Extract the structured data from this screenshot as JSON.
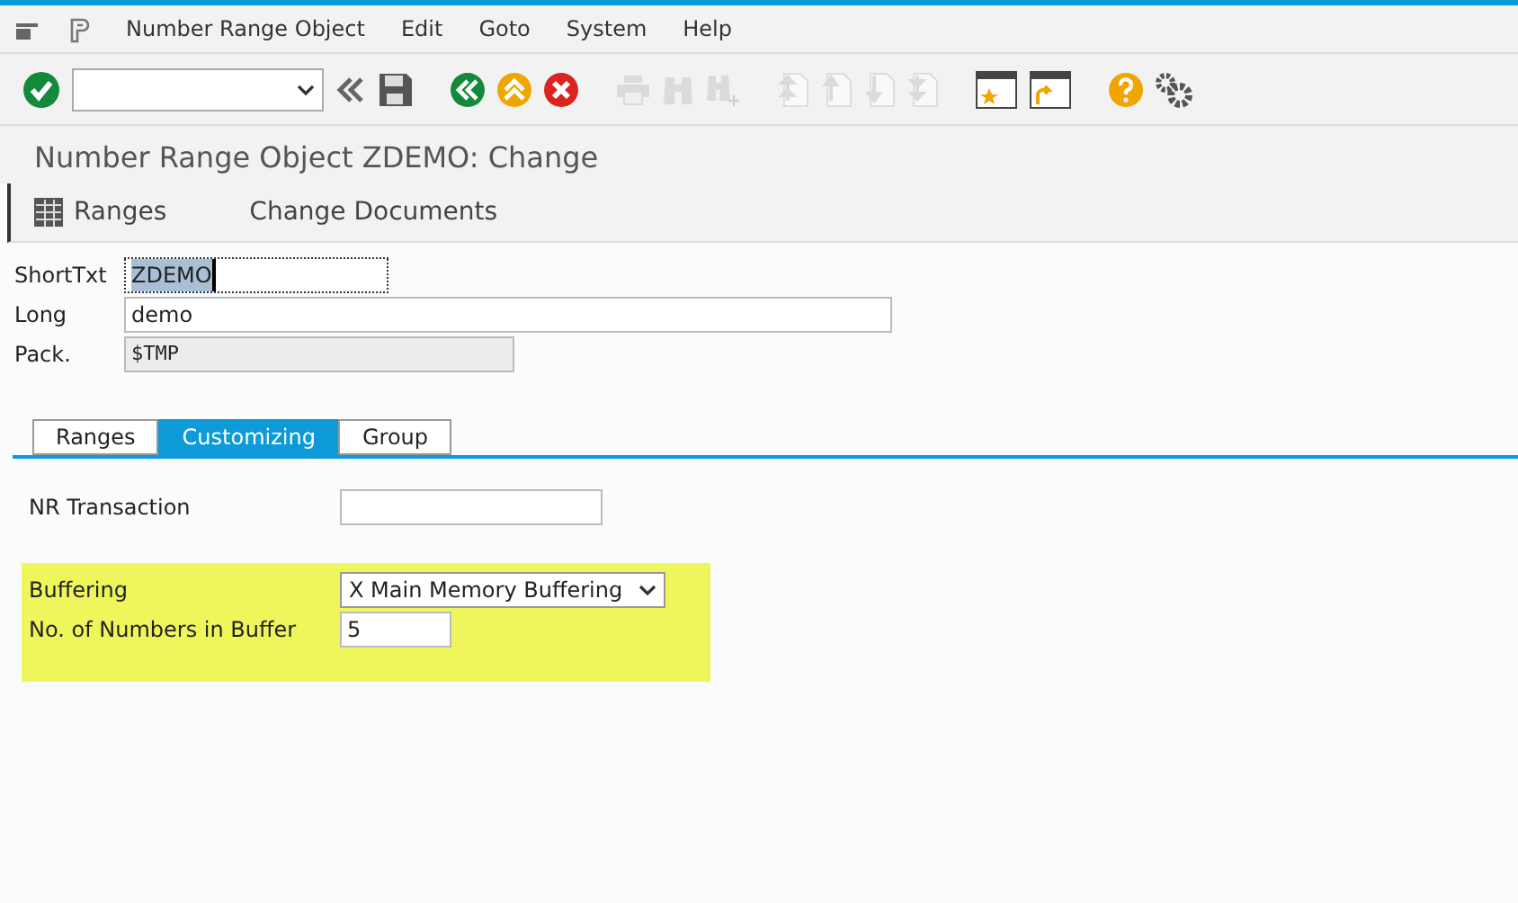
{
  "menu": [
    "Number Range Object",
    "Edit",
    "Goto",
    "System",
    "Help"
  ],
  "toolbar": [
    {
      "kind": "enter",
      "disabled": false
    },
    {
      "kind": "command-field",
      "disabled": false
    },
    {
      "kind": "collapse",
      "disabled": false
    },
    {
      "kind": "save",
      "disabled": false
    },
    {
      "kind": "back",
      "disabled": false
    },
    {
      "kind": "exit",
      "disabled": false
    },
    {
      "kind": "cancel",
      "disabled": false
    },
    {
      "kind": "print",
      "disabled": true
    },
    {
      "kind": "find",
      "disabled": true
    },
    {
      "kind": "find-next",
      "disabled": true
    },
    {
      "kind": "first-page",
      "disabled": true
    },
    {
      "kind": "previous-page",
      "disabled": true
    },
    {
      "kind": "next-page",
      "disabled": true
    },
    {
      "kind": "last-page",
      "disabled": true
    },
    {
      "kind": "new-session",
      "disabled": false
    },
    {
      "kind": "shortcut",
      "disabled": false
    },
    {
      "kind": "help",
      "disabled": false
    },
    {
      "kind": "settings",
      "disabled": false
    }
  ],
  "title": "Number Range Object ZDEMO: Change",
  "app_toolbar": [
    {
      "label": "Ranges",
      "kind": "icon"
    },
    {
      "label": "Change Documents",
      "kind": "plain"
    }
  ],
  "fields": [
    {
      "label": "ShortTxt",
      "value": "ZDEMO",
      "focused": true,
      "disabled": false,
      "kind": "short"
    },
    {
      "label": "Long",
      "value": "demo",
      "focused": false,
      "disabled": false,
      "kind": "long"
    },
    {
      "label": "Pack.",
      "value": "$TMP",
      "focused": false,
      "disabled": true,
      "kind": "medium"
    }
  ],
  "tabs": [
    {
      "label": "Ranges",
      "selected": false
    },
    {
      "label": "Customizing",
      "selected": true
    },
    {
      "label": "Group",
      "selected": false
    }
  ],
  "nr_transaction": {
    "label": "NR Transaction"
  },
  "highlight": {
    "fields": [
      {
        "label": "Buffering",
        "value": "X Main Memory Buffering",
        "kind": "dropdown"
      },
      {
        "label": "No. of Numbers in Buffer",
        "value": "5",
        "kind": "text"
      }
    ]
  }
}
